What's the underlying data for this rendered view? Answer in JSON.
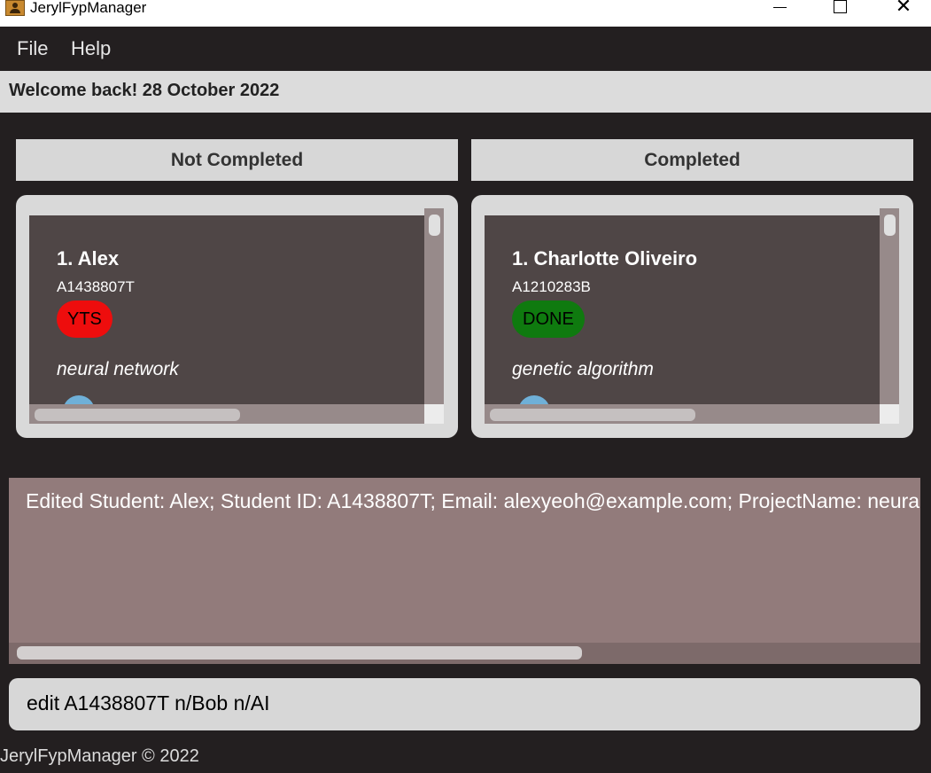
{
  "window": {
    "title": "JerylFypManager",
    "icon": "app-icon",
    "close_glyph": "✕"
  },
  "menu": {
    "items": [
      "File",
      "Help"
    ]
  },
  "welcome": {
    "text": "Welcome back! 28 October 2022"
  },
  "lists": [
    {
      "header": "Not Completed",
      "cards": [
        {
          "index_name": "1.  Alex",
          "student_id": "A1438807T",
          "status": "YTS",
          "status_color": "#ee0d0d",
          "project": "neural network"
        }
      ]
    },
    {
      "header": "Completed",
      "cards": [
        {
          "index_name": "1.  Charlotte Oliveiro",
          "student_id": "A1210283B",
          "status": "DONE",
          "status_color": "#0f7a0f",
          "project": "genetic algorithm"
        }
      ]
    }
  ],
  "result": {
    "text": "Edited Student: Alex; Student ID: A1438807T; Email: alexyeoh@example.com; ProjectName: neural network; Status: YTS"
  },
  "command": {
    "value": "edit A1438807T n/Bob n/AI"
  },
  "footer": {
    "text": "JerylFypManager © 2022"
  }
}
